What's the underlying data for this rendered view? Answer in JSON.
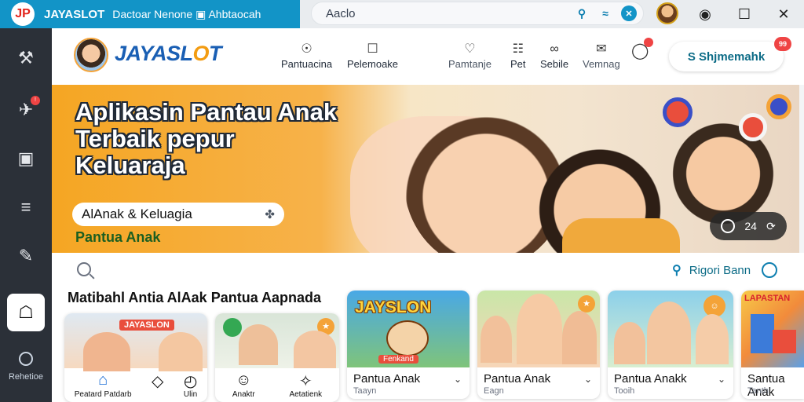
{
  "titlebar": {
    "logo": "JP",
    "brand": "JAYASLOT",
    "title": "Dactoar Nenone ▣ Ahbtaocah",
    "address": "Aaclo",
    "icons": [
      "user-icon",
      "wifi-icon",
      "close-circle-icon"
    ],
    "controls": [
      "theme-icon",
      "maximize-icon",
      "close-icon"
    ]
  },
  "sidebar": {
    "items": [
      {
        "icon": "tool-icon",
        "glyph": "⚒"
      },
      {
        "icon": "rocket-icon",
        "glyph": "✈",
        "badge": "!"
      },
      {
        "icon": "chat-icon",
        "glyph": "▣"
      },
      {
        "icon": "list-icon",
        "glyph": "≡"
      },
      {
        "icon": "feather-icon",
        "glyph": "✎"
      },
      {
        "icon": "basket-icon",
        "glyph": "☖",
        "active": true
      }
    ],
    "bottom_label": "Rehetioe"
  },
  "header": {
    "brand_main": "JAYASL",
    "brand_o": "O",
    "brand_end": "T",
    "nav": [
      {
        "label": "Pantuacina",
        "icon": "☉",
        "name": "nav-pantuacina"
      },
      {
        "label": "Pelemoake",
        "icon": "☐",
        "name": "nav-pelemoake"
      },
      {
        "label": "Pamtanje",
        "icon": "♡",
        "name": "nav-pamtanje"
      },
      {
        "label": "Pet",
        "icon": "☷",
        "name": "nav-pet"
      },
      {
        "label": "Sebile",
        "icon": "∞",
        "name": "nav-sebile"
      },
      {
        "label": "Vemnag",
        "icon": "✉",
        "name": "nav-vemnag"
      }
    ],
    "cta_label": "S Shjmemahk",
    "cta_badge": "99"
  },
  "hero": {
    "title_lines": [
      "Aplikasin Pantau Anak",
      "Terbaik pepur",
      "Keluaraja"
    ],
    "search_value": "AlAnak & Keluagia",
    "search_icon": "✤",
    "subtitle": "Pantua Anak",
    "controls_label": "24"
  },
  "content": {
    "report_label": "Rigori Bann",
    "section_title": "Matibahl Antia AlAak Pantua Aapnada",
    "cards": [
      {
        "label": "Pantua Anak",
        "sub": "Taayn"
      },
      {
        "label": "Pantua Anak",
        "sub": "Eagn"
      },
      {
        "label": "Pantua Anakk",
        "sub": "Tooih"
      },
      {
        "label": "Santua Anak",
        "sub": "Tanth"
      }
    ],
    "card1_banner": "JAYASLON",
    "card3_banner": "JAYSLON",
    "card3_sign": "Fenkand",
    "card6_banner": "LAPASTAN",
    "mini_bar": [
      {
        "label": "Peatard Patdarb",
        "icon": "⌂",
        "name": "mini-home"
      },
      {
        "label": "",
        "icon": "◇",
        "name": "mini-tag"
      },
      {
        "label": "Ulin",
        "icon": "◴",
        "name": "mini-clock"
      },
      {
        "label": "Anaktr",
        "icon": "☺",
        "name": "mini-face"
      },
      {
        "label": "Aetatienk",
        "icon": "✧",
        "name": "mini-gear"
      }
    ]
  },
  "colors": {
    "accent": "#1294c7",
    "brand": "#1a5fb4",
    "hero_orange": "#f5a623",
    "sidebar": "#2b3038"
  }
}
